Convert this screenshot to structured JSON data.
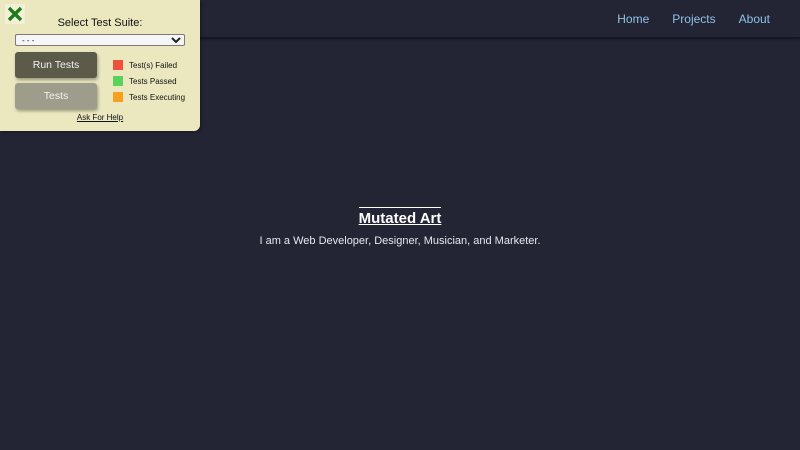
{
  "nav": {
    "items": [
      "Home",
      "Projects",
      "About"
    ],
    "link_color": "#8fc3e6"
  },
  "hero": {
    "title": "Mutated Art",
    "subtitle": "I am a Web Developer, Designer, Musician, and Marketer."
  },
  "test_panel": {
    "close_icon": "close-x-icon",
    "title": "Select Test Suite:",
    "suite_select": {
      "selected": "- - -"
    },
    "run_button_label": "Run Tests",
    "tests_button_label": "Tests",
    "legend": [
      {
        "label": "Test(s) Failed",
        "color": "#f0503c"
      },
      {
        "label": "Tests Passed",
        "color": "#5ad25a"
      },
      {
        "label": "Tests Executing",
        "color": "#f5a01e"
      }
    ],
    "help_link": "Ask For Help"
  },
  "colors": {
    "background": "#232434",
    "panel": "#ebe8c0",
    "close_icon": "#1f7a1f"
  }
}
